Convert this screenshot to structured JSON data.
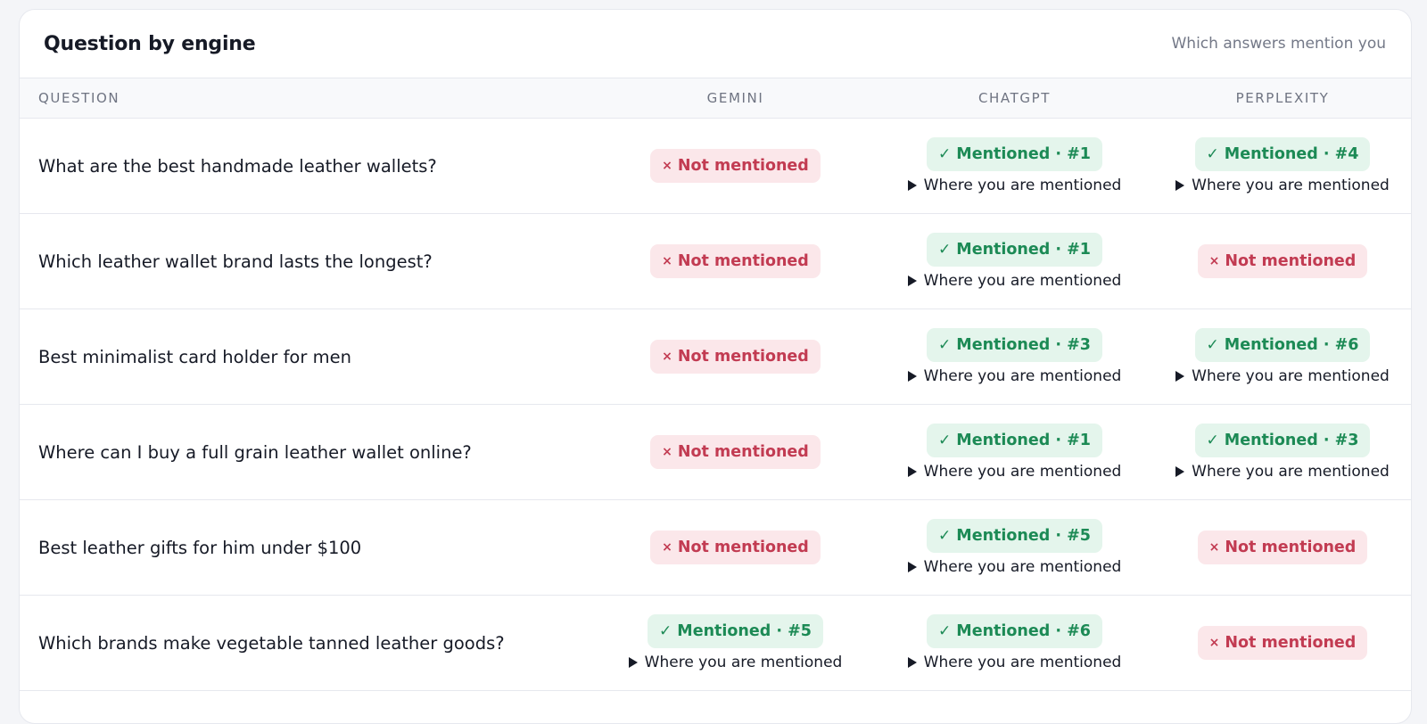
{
  "header": {
    "title": "Question by engine",
    "subtitle": "Which answers mention you"
  },
  "columns": [
    "Question",
    "Gemini",
    "ChatGPT",
    "Perplexity"
  ],
  "labels": {
    "not_mentioned": "Not mentioned",
    "where": "Where you are mentioned",
    "miss_symbol": "×",
    "hit_symbol": "✓"
  },
  "colors": {
    "hit_bg": "#e4f5ec",
    "hit_text": "#1c8a55",
    "miss_bg": "#fbe7ea",
    "miss_text": "#c23b52"
  },
  "rows": [
    {
      "question": "What are the best handmade leather wallets?",
      "gemini": {
        "mentioned": false
      },
      "chatgpt": {
        "mentioned": true,
        "text": "Mentioned · #1"
      },
      "perplexity": {
        "mentioned": true,
        "text": "Mentioned · #4"
      }
    },
    {
      "question": "Which leather wallet brand lasts the longest?",
      "gemini": {
        "mentioned": false
      },
      "chatgpt": {
        "mentioned": true,
        "text": "Mentioned · #1"
      },
      "perplexity": {
        "mentioned": false
      }
    },
    {
      "question": "Best minimalist card holder for men",
      "gemini": {
        "mentioned": false
      },
      "chatgpt": {
        "mentioned": true,
        "text": "Mentioned · #3"
      },
      "perplexity": {
        "mentioned": true,
        "text": "Mentioned · #6"
      }
    },
    {
      "question": "Where can I buy a full grain leather wallet online?",
      "gemini": {
        "mentioned": false
      },
      "chatgpt": {
        "mentioned": true,
        "text": "Mentioned · #1"
      },
      "perplexity": {
        "mentioned": true,
        "text": "Mentioned · #3"
      }
    },
    {
      "question": "Best leather gifts for him under $100",
      "gemini": {
        "mentioned": false
      },
      "chatgpt": {
        "mentioned": true,
        "text": "Mentioned · #5"
      },
      "perplexity": {
        "mentioned": false
      }
    },
    {
      "question": "Which brands make vegetable tanned leather goods?",
      "gemini": {
        "mentioned": true,
        "text": "Mentioned · #5"
      },
      "chatgpt": {
        "mentioned": true,
        "text": "Mentioned · #6"
      },
      "perplexity": {
        "mentioned": false
      }
    }
  ]
}
